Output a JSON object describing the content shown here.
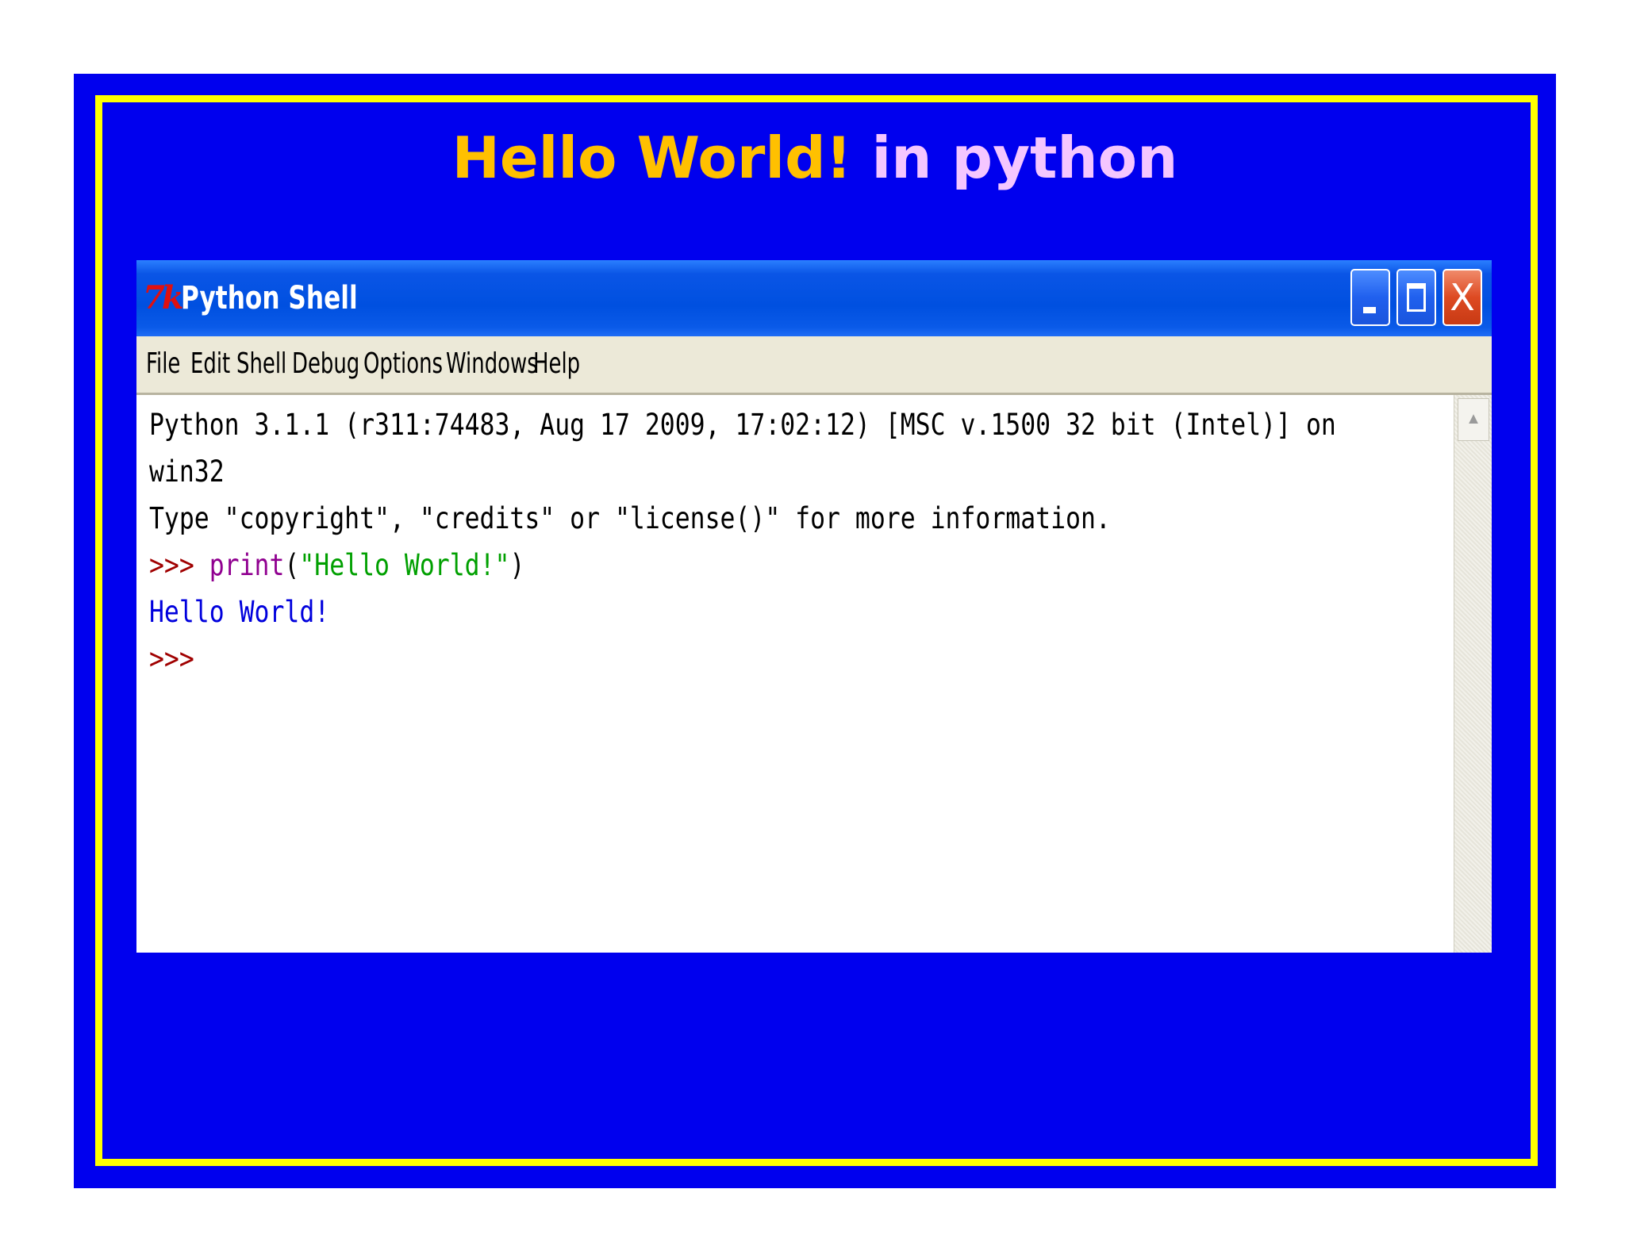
{
  "slide": {
    "title_part1": "Hello World!",
    "title_part2": " in python",
    "colors": {
      "background": "#0000ee",
      "border": "#ffff00",
      "title_part1": "#ffc000",
      "title_part2": "#f4c6ff"
    }
  },
  "window": {
    "icon_text": "7k",
    "title": "Python Shell",
    "buttons": {
      "minimize_icon": "minimize-icon",
      "maximize_icon": "maximize-icon",
      "close_icon": "close-icon",
      "close_glyph": "X"
    }
  },
  "menu": {
    "items": [
      "File",
      "Edit",
      "Shell",
      "Debug",
      "Options",
      "Windows",
      "Help"
    ]
  },
  "shell": {
    "banner_line1": "Python 3.1.1 (r311:74483, Aug 17 2009, 17:02:12) [MSC v.1500 32 bit (Intel)] on",
    "banner_line2": "win32",
    "banner_line3": "Type \"copyright\", \"credits\" or \"license()\" for more information.",
    "prompt": ">>> ",
    "command_builtin": "print",
    "command_open": "(",
    "command_string": "\"Hello World!\"",
    "command_close": ")",
    "output": "Hello World!",
    "final_prompt": ">>>"
  },
  "scrollbar": {
    "up_glyph": "▲"
  }
}
